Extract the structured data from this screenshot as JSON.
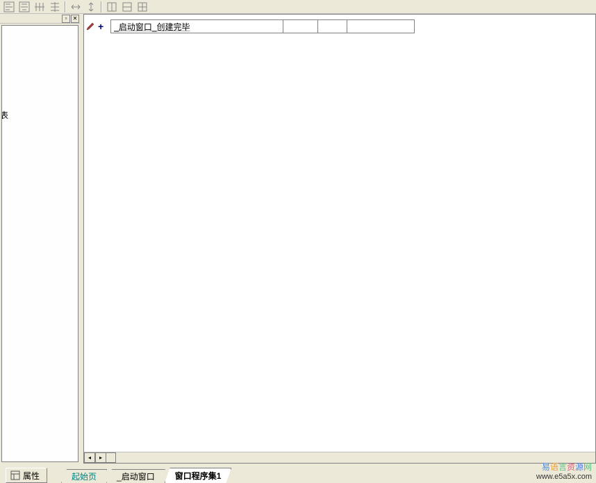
{
  "editor": {
    "row_label": "_启动窗口_创建完毕"
  },
  "left_panel": {
    "clipped": "表"
  },
  "bottom": {
    "properties_label": "属性",
    "tabs": {
      "start": "起始页",
      "startup_window": "_启动窗口",
      "window_proc_set": "窗口程序集1"
    }
  },
  "watermark": {
    "line1": "易语言资源网",
    "line2": "www.e5a5x.com"
  }
}
